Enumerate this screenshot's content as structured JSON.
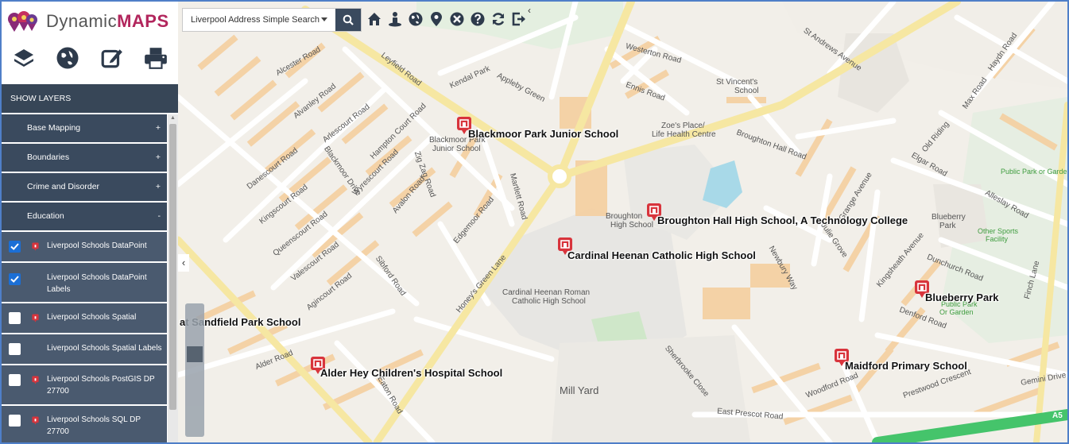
{
  "app": {
    "brand_prefix": "Dynamic",
    "brand_suffix": "MAPS"
  },
  "sidebar": {
    "tool_icons": [
      "layers-icon",
      "globe-icon",
      "edit-icon",
      "print-icon"
    ],
    "show_layers": "SHOW LAYERS",
    "groups": [
      {
        "label": "Base Mapping",
        "toggle": "+"
      },
      {
        "label": "Boundaries",
        "toggle": "+"
      },
      {
        "label": "Crime and Disorder",
        "toggle": "+"
      },
      {
        "label": "Education",
        "toggle": "-"
      }
    ],
    "layers": [
      {
        "line1": "Liverpool Schools DataPoint",
        "line2": "",
        "checked": true,
        "icon": "school-icon"
      },
      {
        "line1": "Liverpool Schools DataPoint",
        "line2": "Labels",
        "checked": true,
        "icon": ""
      },
      {
        "line1": "Liverpool Schools Spatial",
        "line2": "",
        "checked": false,
        "icon": "school-icon"
      },
      {
        "line1": "Liverpool Schools Spatial Labels",
        "line2": "",
        "checked": false,
        "icon": ""
      },
      {
        "line1": "Liverpool Schools PostGIS DP",
        "line2": "27700",
        "checked": false,
        "icon": "school-icon"
      },
      {
        "line1": "Liverpool Schools SQL DP",
        "line2": "27700",
        "checked": false,
        "icon": "school-icon"
      }
    ]
  },
  "search": {
    "selected": "Liverpool Address Simple Search"
  },
  "toolbar_icons": [
    "home-icon",
    "person-icon",
    "globe-icon",
    "location-pin-icon",
    "crosshair-icon",
    "help-icon",
    "refresh-icon",
    "logout-icon"
  ],
  "map": {
    "schools": [
      "Blackmoor Park Junior School",
      "Broughton Hall High School, A Technology College",
      "Cardinal Heenan Catholic High School",
      "Blueberry Park",
      "at Sandfield Park School",
      "Alder Hey Children's Hospital School",
      "Maidford Primary School"
    ],
    "place_labels": [
      "St Vincent's",
      "School",
      "Zoe's Place/",
      "Life Health Centre",
      "Blackmoor Park",
      "Junior School",
      "Broughton",
      "High School",
      "Cardinal Heenan Roman",
      "Catholic High School",
      "Blueberry",
      "Park",
      "Mill Yard"
    ],
    "green_labels": [
      "Public Park or Garde",
      "Other Sports",
      "Facility",
      "Public Park",
      "Or Garden"
    ],
    "roads": [
      "Leyfield Road",
      "Westerton Road",
      "Kendal Park",
      "Appleby Green",
      "Ennis Road",
      "Alvanley Road",
      "Arlescourt Road",
      "Hampton Court Road",
      "Danescourt Road",
      "Kingscourt Road",
      "Queenscourt Road",
      "Wyrescourt Road",
      "Avalon Road",
      "Edgemoor Road",
      "Martlett Road",
      "Honey's Green Lane",
      "Valescourt Road",
      "Agincourt Road",
      "Sibford Road",
      "Alder Road",
      "Eaton Road",
      "Grange Avenue",
      "Newbury Way",
      "Julie Grove",
      "Kingsheath Avenue",
      "Dunchurch Road",
      "Denford Road",
      "Woodford Road",
      "Prestwood Crescent",
      "East Prescot Road",
      "Sherbrooke Close",
      "Max Road",
      "Haydn Road",
      "Elgar Road",
      "Alleslay Road",
      "Finch Lane",
      "Gemini Drive",
      "St Andrews Avenue",
      "Old Riding",
      "Alcester Road",
      "Broughton Hall Road",
      "Blackmoor Drive",
      "Zig Zag Road"
    ],
    "motorway_tag": "A5"
  },
  "colors": {
    "sidebar": "#3a4a5e",
    "brand": "#b2265d",
    "school_pin": "#d8343c",
    "frame": "#4f7fc8"
  }
}
